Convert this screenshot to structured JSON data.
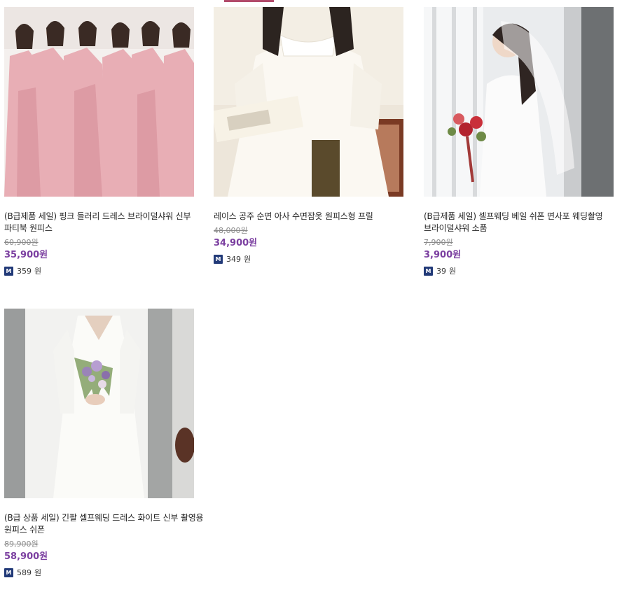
{
  "products": [
    {
      "title": "(B급제품 세일) 핑크 들러리 드레스 브라이덜샤워 신부 파티북 원피스",
      "original_price": "60,900원",
      "price": "35,900원",
      "points": "359",
      "points_unit": "원",
      "badge": "M"
    },
    {
      "title": "레이스 공주 순면 아사 수면잠옷 원피스형 프릴",
      "original_price": "48,000원",
      "price": "34,900원",
      "points": "349",
      "points_unit": "원",
      "badge": "M"
    },
    {
      "title": "(B급제품 세일) 셀프웨딩 베일 쉬폰 면사포 웨딩촬영 브라이덜샤워 소품",
      "original_price": "7,900원",
      "price": "3,900원",
      "points": "39",
      "points_unit": "원",
      "badge": "M"
    },
    {
      "title": "(B급 상품 세일) 긴팔 셀프웨딩 드레스 화이트 신부 촬영용 원피스 쉬폰",
      "original_price": "89,900원",
      "price": "58,900원",
      "points": "589",
      "points_unit": "원",
      "badge": "M"
    }
  ],
  "colors": {
    "price": "#7b3fa0",
    "badge": "#223a78",
    "accent_bar": "#b24a6a"
  }
}
